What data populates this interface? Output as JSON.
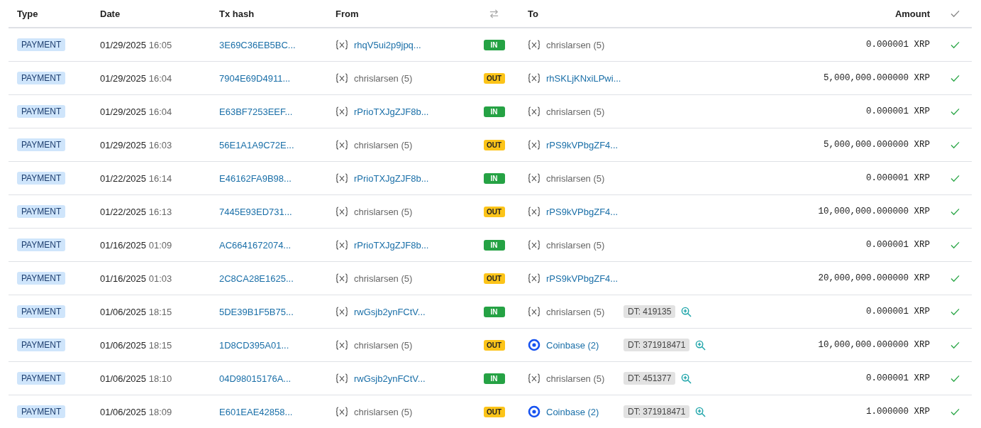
{
  "columns": {
    "type": "Type",
    "date": "Date",
    "hash": "Tx hash",
    "from": "From",
    "to": "To",
    "amount": "Amount"
  },
  "rows": [
    {
      "type": "PAYMENT",
      "date": "01/29/2025",
      "time": "16:05",
      "hash": "3E69C36EB5BC...",
      "from": {
        "text": "rhqV5ui2p9jpq...",
        "kind": "address"
      },
      "direction": {
        "text": "IN",
        "kind": "in"
      },
      "to": {
        "text": "chrislarsen (5)",
        "kind": "user"
      },
      "amount": "0.000001 XRP",
      "success": true
    },
    {
      "type": "PAYMENT",
      "date": "01/29/2025",
      "time": "16:04",
      "hash": "7904E69D4911...",
      "from": {
        "text": "chrislarsen (5)",
        "kind": "user"
      },
      "direction": {
        "text": "OUT",
        "kind": "out"
      },
      "to": {
        "text": "rhSKLjKNxiLPwi...",
        "kind": "address"
      },
      "amount": "5,000,000.000000 XRP",
      "success": true
    },
    {
      "type": "PAYMENT",
      "date": "01/29/2025",
      "time": "16:04",
      "hash": "E63BF7253EEF...",
      "from": {
        "text": "rPrioTXJgZJF8b...",
        "kind": "address"
      },
      "direction": {
        "text": "IN",
        "kind": "in"
      },
      "to": {
        "text": "chrislarsen (5)",
        "kind": "user"
      },
      "amount": "0.000001 XRP",
      "success": true
    },
    {
      "type": "PAYMENT",
      "date": "01/29/2025",
      "time": "16:03",
      "hash": "56E1A1A9C72E...",
      "from": {
        "text": "chrislarsen (5)",
        "kind": "user"
      },
      "direction": {
        "text": "OUT",
        "kind": "out"
      },
      "to": {
        "text": "rPS9kVPbgZF4...",
        "kind": "address"
      },
      "amount": "5,000,000.000000 XRP",
      "success": true
    },
    {
      "type": "PAYMENT",
      "date": "01/22/2025",
      "time": "16:14",
      "hash": "E46162FA9B98...",
      "from": {
        "text": "rPrioTXJgZJF8b...",
        "kind": "address"
      },
      "direction": {
        "text": "IN",
        "kind": "in"
      },
      "to": {
        "text": "chrislarsen (5)",
        "kind": "user"
      },
      "amount": "0.000001 XRP",
      "success": true
    },
    {
      "type": "PAYMENT",
      "date": "01/22/2025",
      "time": "16:13",
      "hash": "7445E93ED731...",
      "from": {
        "text": "chrislarsen (5)",
        "kind": "user"
      },
      "direction": {
        "text": "OUT",
        "kind": "out"
      },
      "to": {
        "text": "rPS9kVPbgZF4...",
        "kind": "address"
      },
      "amount": "10,000,000.000000 XRP",
      "success": true
    },
    {
      "type": "PAYMENT",
      "date": "01/16/2025",
      "time": "01:09",
      "hash": "AC6641672074...",
      "from": {
        "text": "rPrioTXJgZJF8b...",
        "kind": "address"
      },
      "direction": {
        "text": "IN",
        "kind": "in"
      },
      "to": {
        "text": "chrislarsen (5)",
        "kind": "user"
      },
      "amount": "0.000001 XRP",
      "success": true
    },
    {
      "type": "PAYMENT",
      "date": "01/16/2025",
      "time": "01:03",
      "hash": "2C8CA28E1625...",
      "from": {
        "text": "chrislarsen (5)",
        "kind": "user"
      },
      "direction": {
        "text": "OUT",
        "kind": "out"
      },
      "to": {
        "text": "rPS9kVPbgZF4...",
        "kind": "address"
      },
      "amount": "20,000,000.000000 XRP",
      "success": true
    },
    {
      "type": "PAYMENT",
      "date": "01/06/2025",
      "time": "18:15",
      "hash": "5DE39B1F5B75...",
      "from": {
        "text": "rwGsjb2ynFCtV...",
        "kind": "address"
      },
      "direction": {
        "text": "IN",
        "kind": "in"
      },
      "to": {
        "text": "chrislarsen (5)",
        "kind": "user"
      },
      "tag": "DT: 419135",
      "amount": "0.000001 XRP",
      "success": true
    },
    {
      "type": "PAYMENT",
      "date": "01/06/2025",
      "time": "18:15",
      "hash": "1D8CD395A01...",
      "from": {
        "text": "chrislarsen (5)",
        "kind": "user"
      },
      "direction": {
        "text": "OUT",
        "kind": "out"
      },
      "to": {
        "text": "Coinbase (2)",
        "kind": "exchange"
      },
      "tag": "DT: 371918471",
      "amount": "10,000,000.000000 XRP",
      "success": true
    },
    {
      "type": "PAYMENT",
      "date": "01/06/2025",
      "time": "18:10",
      "hash": "04D98015176A...",
      "from": {
        "text": "rwGsjb2ynFCtV...",
        "kind": "address"
      },
      "direction": {
        "text": "IN",
        "kind": "in"
      },
      "to": {
        "text": "chrislarsen (5)",
        "kind": "user"
      },
      "tag": "DT: 451377",
      "amount": "0.000001 XRP",
      "success": true
    },
    {
      "type": "PAYMENT",
      "date": "01/06/2025",
      "time": "18:09",
      "hash": "E601EAE42858...",
      "from": {
        "text": "chrislarsen (5)",
        "kind": "user"
      },
      "direction": {
        "text": "OUT",
        "kind": "out"
      },
      "to": {
        "text": "Coinbase (2)",
        "kind": "exchange"
      },
      "tag": "DT: 371918471",
      "amount": "1.000000 XRP",
      "success": true
    }
  ]
}
